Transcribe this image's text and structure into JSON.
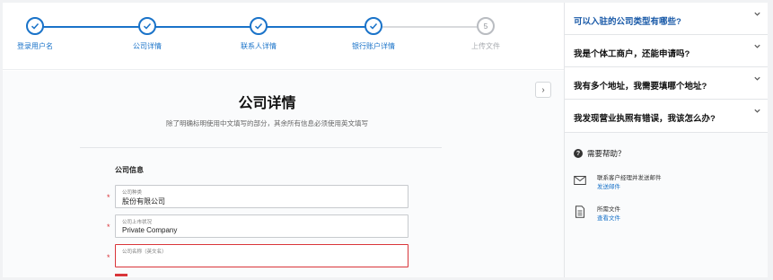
{
  "stepper": {
    "steps": [
      {
        "label": "登录用户名",
        "state": "done"
      },
      {
        "label": "公司详情",
        "state": "done"
      },
      {
        "label": "联系人详情",
        "state": "done"
      },
      {
        "label": "银行账户详情",
        "state": "done"
      },
      {
        "label": "上传文件",
        "state": "pending",
        "number": "5"
      }
    ]
  },
  "main": {
    "title": "公司详情",
    "subtitle": "除了明确标明使用中文填写的部分，其余所有信息必须使用英文填写",
    "section_title": "公司信息",
    "fields": [
      {
        "label": "公司种类",
        "value": "股份有限公司",
        "required": "*",
        "error": false
      },
      {
        "label": "公司上市状况",
        "value": "Private Company",
        "required": "*",
        "error": false
      },
      {
        "label": "公司名称（英文名）",
        "value": "",
        "required": "*",
        "error": true
      }
    ]
  },
  "sidebar": {
    "faqs": [
      {
        "question": "可以入驻的公司类型有哪些?",
        "active": true
      },
      {
        "question": "我是个体工商户，还能申请吗?",
        "active": false
      },
      {
        "question": "我有多个地址，我需要填哪个地址?",
        "active": false
      },
      {
        "question": "我发现营业执照有错误，我该怎么办?",
        "active": false
      }
    ],
    "help": {
      "title": "需要帮助？",
      "items": [
        {
          "icon": "envelope-icon",
          "title": "联系客户经理并发送邮件",
          "link": "发送邮件"
        },
        {
          "icon": "document-icon",
          "title": "所需文件",
          "link": "查看文件"
        }
      ]
    }
  },
  "colors": {
    "accent": "#1a73c9",
    "error": "#d9353a",
    "faq_active": "#1a5aa8"
  }
}
